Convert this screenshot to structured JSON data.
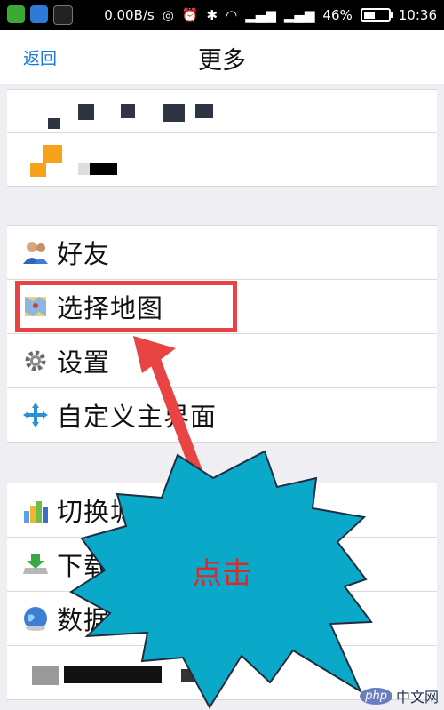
{
  "statusbar": {
    "speed": "0.00B/s",
    "battery": "46%",
    "battery_level": 0.46,
    "time": "10:36",
    "icons": [
      "location-icon",
      "alarm-icon",
      "bluetooth-icon",
      "wifi-icon",
      "signal-icon",
      "signal-icon"
    ]
  },
  "header": {
    "back_label": "返回",
    "title": "更多"
  },
  "groups": {
    "main": [
      {
        "label": "好友",
        "icon": "friends-icon"
      },
      {
        "label": "选择地图",
        "icon": "map-icon"
      },
      {
        "label": "设置",
        "icon": "gear-icon"
      },
      {
        "label": "自定义主界面",
        "icon": "customize-arrows-icon"
      }
    ],
    "tools": [
      {
        "label": "切换城",
        "icon": "bar-chart-icon"
      },
      {
        "label": "下载",
        "icon": "download-icon"
      },
      {
        "label": "数据",
        "icon": "globe-icon"
      }
    ]
  },
  "annotation": {
    "callout_text": "点击",
    "highlight_color": "#e94344"
  },
  "watermark": {
    "brand": "php",
    "site": "中文网"
  }
}
